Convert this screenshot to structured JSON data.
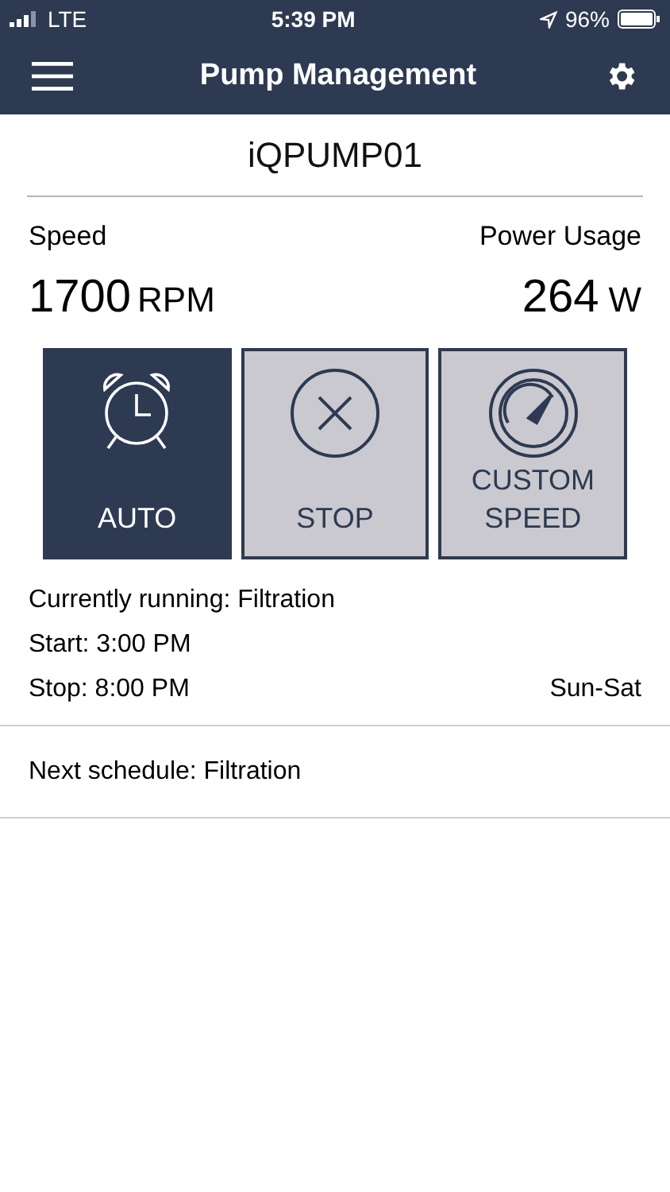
{
  "status_bar": {
    "carrier": "LTE",
    "time": "5:39 PM",
    "battery": "96%"
  },
  "nav": {
    "title": "Pump Management"
  },
  "pump_name": "iQPUMP01",
  "speed": {
    "label": "Speed",
    "value": "1700",
    "unit": "RPM"
  },
  "power": {
    "label": "Power Usage",
    "value": "264",
    "unit": "W"
  },
  "modes": [
    {
      "kind": "auto",
      "label": "AUTO",
      "selected": true
    },
    {
      "kind": "stop",
      "label": "STOP",
      "selected": false
    },
    {
      "kind": "custom",
      "label": "CUSTOM SPEED",
      "selected": false
    }
  ],
  "current": {
    "running": "Currently running: Filtration",
    "start": "Start: 3:00 PM",
    "stop": "Stop: 8:00 PM",
    "days": "Sun-Sat"
  },
  "next_schedule": "Next schedule: Filtration"
}
